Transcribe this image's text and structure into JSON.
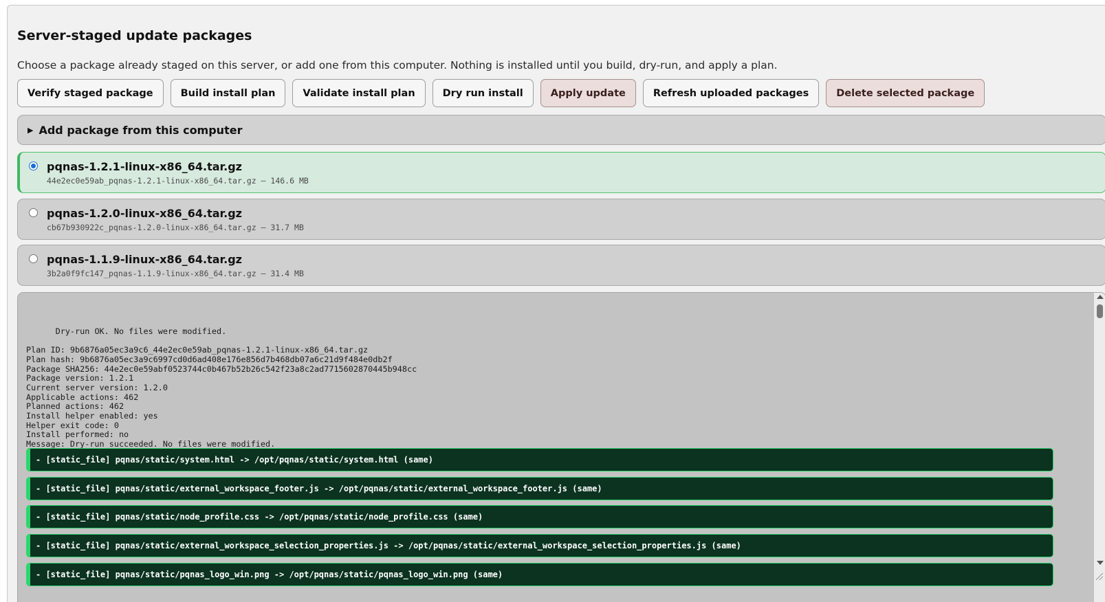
{
  "section": {
    "title": "Server-staged update packages",
    "subtitle": "Choose a package already staged on this server, or add one from this computer. Nothing is installed until you build, dry-run, and apply a plan."
  },
  "toolbar": {
    "verify_label": "Verify staged package",
    "build_label": "Build install plan",
    "validate_label": "Validate install plan",
    "dry_run_label": "Dry run install",
    "apply_label": "Apply update",
    "refresh_label": "Refresh uploaded packages",
    "delete_label": "Delete selected package"
  },
  "add_package": {
    "label": "Add package from this computer",
    "state": "collapsed"
  },
  "packages": [
    {
      "name": "pqnas-1.2.1-linux-x86_64.tar.gz",
      "meta": "44e2ec0e59ab_pqnas-1.2.1-linux-x86_64.tar.gz — 146.6 MB",
      "selected": true
    },
    {
      "name": "pqnas-1.2.0-linux-x86_64.tar.gz",
      "meta": "cb67b930922c_pqnas-1.2.0-linux-x86_64.tar.gz — 31.7 MB",
      "selected": false
    },
    {
      "name": "pqnas-1.1.9-linux-x86_64.tar.gz",
      "meta": "3b2a0f9fc147_pqnas-1.1.9-linux-x86_64.tar.gz — 31.4 MB",
      "selected": false
    }
  ],
  "log": {
    "status_line": "Dry-run OK. No files were modified.",
    "lines": [
      "Plan ID: 9b6876a05ec3a9c6_44e2ec0e59ab_pqnas-1.2.1-linux-x86_64.tar.gz",
      "Plan hash: 9b6876a05ec3a9c6997cd0d6ad408e176e856d7b468db07a6c21d9f484e0db2f",
      "Package SHA256: 44e2ec0e59abf0523744c0b467b52b26c542f23a8c2ad7715602870445b948cc",
      "Package version: 1.2.1",
      "Current server version: 1.2.0",
      "Applicable actions: 462",
      "Planned actions: 462",
      "Install helper enabled: yes",
      "Helper exit code: 0",
      "Install performed: no",
      "Message: Dry-run succeeded. No files were modified."
    ],
    "actions": [
      "- [static_file] pqnas/static/system.html -> /opt/pqnas/static/system.html (same)",
      "- [static_file] pqnas/static/external_workspace_footer.js -> /opt/pqnas/static/external_workspace_footer.js (same)",
      "- [static_file] pqnas/static/node_profile.css -> /opt/pqnas/static/node_profile.css (same)",
      "- [static_file] pqnas/static/external_workspace_selection_properties.js -> /opt/pqnas/static/external_workspace_selection_properties.js (same)",
      "- [static_file] pqnas/static/pqnas_logo_win.png -> /opt/pqnas/static/pqnas_logo_win.png (same)"
    ]
  },
  "colors": {
    "panel_bg": "#f1f1f1",
    "selected_bg": "#d6eadd",
    "selected_border": "#41b863",
    "action_bg": "#0b3320",
    "action_border": "#2fd56d",
    "danger_bg": "#ecdddd"
  },
  "icons": {
    "expand": "triangle-right-icon",
    "radio_selected": "radio-checked-icon",
    "radio_unselected": "radio-unchecked-icon"
  }
}
